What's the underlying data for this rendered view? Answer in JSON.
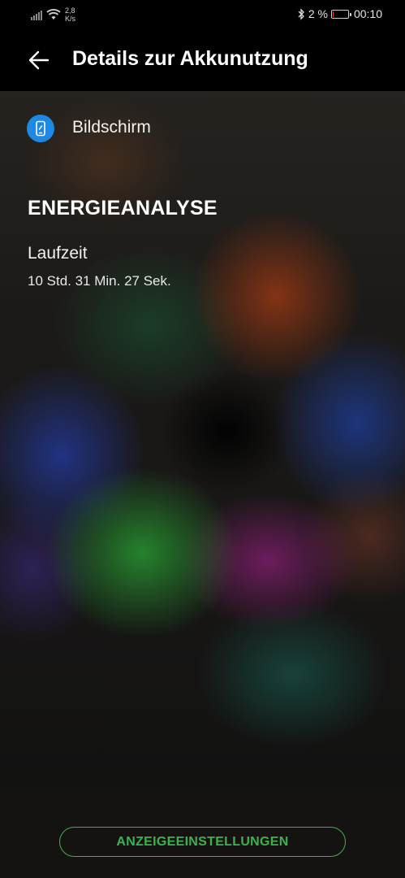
{
  "status_bar": {
    "net_speed_value": "2,8",
    "net_speed_unit": "K/s",
    "battery_text": "2 %",
    "battery_level_percent": 2,
    "time": "00:10",
    "icons": [
      "signal-icon",
      "wifi-icon",
      "bluetooth-icon",
      "battery-icon"
    ]
  },
  "app_bar": {
    "title": "Details zur Akkunutzung",
    "back_icon": "back-arrow-icon"
  },
  "app_item": {
    "label": "Bildschirm",
    "icon": "screen-icon",
    "icon_color": "#1e88e5"
  },
  "energy_analysis": {
    "section_title": "ENERGIEANALYSE",
    "runtime_label": "Laufzeit",
    "runtime_value": "10 Std. 31 Min. 27 Sek."
  },
  "bottom_button": {
    "label": "ANZEIGEEINSTELLUNGEN",
    "color": "#3cb34a"
  },
  "colors": {
    "battery_low": "#e53935",
    "background": "#000000"
  }
}
